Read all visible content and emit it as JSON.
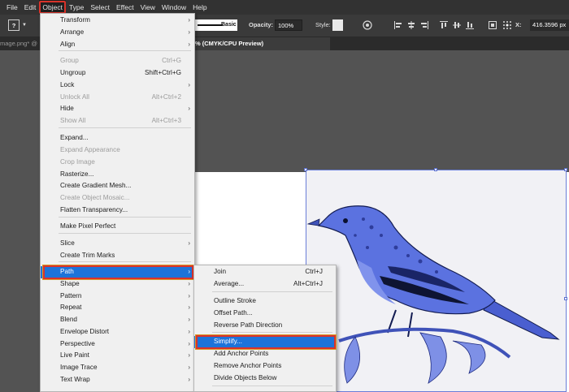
{
  "menubar": {
    "items": [
      "File",
      "Edit",
      "Object",
      "Type",
      "Select",
      "Effect",
      "View",
      "Window",
      "Help"
    ]
  },
  "controlbar": {
    "question_icon": "?",
    "stroke_style": "Basic",
    "opacity_label": "Opacity:",
    "opacity_value": "100%",
    "style_label": "Style:",
    "coord_label": "X:",
    "coord_value": "416.3596 px"
  },
  "tabs": {
    "doc1": "mage.png* @",
    "doc2": "% (CMYK/CPU Preview)"
  },
  "object_menu": {
    "items": [
      {
        "label": "Transform",
        "sub": true
      },
      {
        "label": "Arrange",
        "sub": true
      },
      {
        "label": "Align",
        "sub": true
      },
      {
        "label": "Group",
        "shortcut": "Ctrl+G",
        "disabled": true
      },
      {
        "label": "Ungroup",
        "shortcut": "Shift+Ctrl+G"
      },
      {
        "label": "Lock",
        "sub": true
      },
      {
        "label": "Unlock All",
        "shortcut": "Alt+Ctrl+2",
        "disabled": true
      },
      {
        "label": "Hide",
        "sub": true
      },
      {
        "label": "Show All",
        "shortcut": "Alt+Ctrl+3",
        "disabled": true
      },
      {
        "label": "Expand..."
      },
      {
        "label": "Expand Appearance",
        "disabled": true
      },
      {
        "label": "Crop Image",
        "disabled": true
      },
      {
        "label": "Rasterize..."
      },
      {
        "label": "Create Gradient Mesh..."
      },
      {
        "label": "Create Object Mosaic...",
        "disabled": true
      },
      {
        "label": "Flatten Transparency..."
      },
      {
        "label": "Make Pixel Perfect"
      },
      {
        "label": "Slice",
        "sub": true
      },
      {
        "label": "Create Trim Marks"
      },
      {
        "label": "Path",
        "sub": true,
        "highlighted": true
      },
      {
        "label": "Shape",
        "sub": true
      },
      {
        "label": "Pattern",
        "sub": true
      },
      {
        "label": "Repeat",
        "sub": true
      },
      {
        "label": "Blend",
        "sub": true
      },
      {
        "label": "Envelope Distort",
        "sub": true
      },
      {
        "label": "Perspective",
        "sub": true
      },
      {
        "label": "Live Paint",
        "sub": true
      },
      {
        "label": "Image Trace",
        "sub": true
      },
      {
        "label": "Text Wrap",
        "sub": true
      }
    ]
  },
  "path_menu": {
    "items": [
      {
        "label": "Join",
        "shortcut": "Ctrl+J"
      },
      {
        "label": "Average...",
        "shortcut": "Alt+Ctrl+J"
      },
      {
        "label": "Outline Stroke"
      },
      {
        "label": "Offset Path..."
      },
      {
        "label": "Reverse Path Direction"
      },
      {
        "label": "Simplify...",
        "highlighted": true
      },
      {
        "label": "Add Anchor Points"
      },
      {
        "label": "Remove Anchor Points"
      },
      {
        "label": "Divide Objects Below"
      }
    ]
  },
  "colors": {
    "highlight": "#1d73d9",
    "annotation": "#d9332a",
    "bird": "#5b72e0"
  },
  "icons": {
    "submenu": "chevron-right-icon",
    "bird": "bird-image"
  }
}
